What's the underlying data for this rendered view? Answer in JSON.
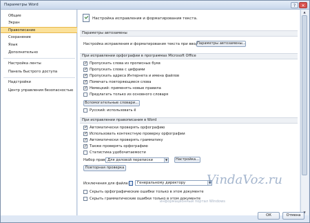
{
  "window": {
    "title": "Параметры Word",
    "help_glyph": "?",
    "close_glyph": "✕"
  },
  "sidebar": {
    "items": [
      {
        "label": "Общие"
      },
      {
        "label": "Экран"
      },
      {
        "label": "Правописание",
        "selected": true
      },
      {
        "label": "Сохранение"
      },
      {
        "label": "Язык"
      },
      {
        "label": "Дополнительно"
      },
      {
        "label": "Настройка ленты"
      },
      {
        "label": "Панель быстрого доступа"
      },
      {
        "label": "Надстройки"
      },
      {
        "label": "Центр управления безопасностью"
      }
    ]
  },
  "header": {
    "text": "Настройка исправления и форматирования текста.",
    "icon": "abc-check-icon"
  },
  "autocorrect": {
    "section_title": "Параметры автозамены",
    "desc": "Настройка исправления и форматирования текста при вводе:",
    "button": "Параметры автозамены..."
  },
  "office_spelling": {
    "section_title": "При исправлении орфографии в программах Microsoft Office",
    "checkboxes": [
      {
        "label": "Пропускать слова из прописных букв",
        "checked": true
      },
      {
        "label": "Пропускать слова с цифрами",
        "checked": true
      },
      {
        "label": "Пропускать адреса Интернета и имена файлов",
        "checked": true
      },
      {
        "label": "Помечать повторяющиеся слова",
        "checked": true
      },
      {
        "label": "Немецкий: применять новые правила",
        "checked": true
      },
      {
        "label": "Предлагать только из основного словаря",
        "checked": false
      }
    ],
    "dictionaries_button": "Вспомогательные словари...",
    "russian_checkbox": {
      "label": "Русский: использовать ё",
      "checked": false
    }
  },
  "word_spelling": {
    "section_title": "При исправлении правописания в Word",
    "checkboxes": [
      {
        "label": "Автоматически проверять орфографию",
        "checked": true
      },
      {
        "label": "Использовать контекстную проверку орфографии",
        "checked": true
      },
      {
        "label": "Автоматически проверять грамматику",
        "checked": true
      },
      {
        "label": "Также проверять орфографию",
        "checked": true
      },
      {
        "label": "Статистика удобочитаемости",
        "checked": false
      }
    ],
    "ruleset_label": "Набор правил:",
    "ruleset_value": "Для деловой переписки",
    "settings_button": "Настройка...",
    "recheck_button": "Повторная проверка"
  },
  "exceptions": {
    "label": "Исключения для файла:",
    "file_value": "Генеральному директору",
    "checkboxes": [
      {
        "label": "Скрыть орфографические ошибки только в этом документе",
        "checked": false
      },
      {
        "label": "Скрыть грамматические ошибки только в этом документе",
        "checked": false
      }
    ]
  },
  "footer": {
    "ok": "ОК",
    "cancel": "Отмена"
  },
  "watermark": {
    "text": "VindaVoz.ru",
    "subtext": "информационный портал Windows"
  }
}
